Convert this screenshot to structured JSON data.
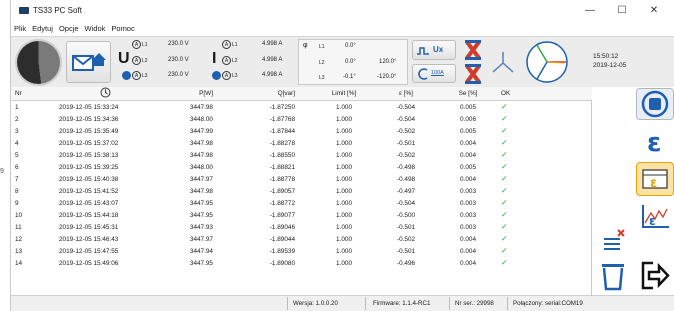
{
  "window": {
    "title": "TS33 PC Soft"
  },
  "window_controls": {
    "minimize": "—",
    "maximize": "☐",
    "close": "✕"
  },
  "menu": [
    "Plik",
    "Edytuj",
    "Opcje",
    "Widok",
    "Pomoc"
  ],
  "meters": {
    "u_symbol": "U",
    "i_symbol": "I",
    "phi_symbol": "φ",
    "voltage": [
      {
        "label": "L1",
        "value": "230.0 V"
      },
      {
        "label": "L2",
        "value": "230.0 V"
      },
      {
        "label": "L3",
        "value": "230.0 V"
      }
    ],
    "current": [
      {
        "label": "L1",
        "value": "4.998 A"
      },
      {
        "label": "L2",
        "value": "4.998 A"
      },
      {
        "label": "L3",
        "value": "4.998 A"
      }
    ],
    "phase": [
      {
        "label": "L1",
        "angle": "0.0°",
        "extra": ""
      },
      {
        "label": "L2",
        "angle": "0.0°",
        "extra": "120.0°"
      },
      {
        "label": "L3",
        "angle": "-0.1°",
        "extra": "-120.0°"
      }
    ],
    "ux_label": "Ux",
    "ct_label": "100A"
  },
  "clock": {
    "time": "15:50:12",
    "date": "2019-12-05"
  },
  "table": {
    "headers": [
      "Nr",
      "",
      "P[W]",
      "Q[var]",
      "Limit [%]",
      "ε [%]",
      "Se [%]",
      "OK"
    ],
    "rows": [
      [
        "1",
        "2019-12-05 15:33:24",
        "3447.98",
        "-1.87250",
        "1.000",
        "-0.504",
        "0.005",
        "✓"
      ],
      [
        "2",
        "2019-12-05 15:34:36",
        "3448.00",
        "-1.87768",
        "1.000",
        "-0.504",
        "0.006",
        "✓"
      ],
      [
        "3",
        "2019-12-05 15:35:49",
        "3447.99",
        "-1.87844",
        "1.000",
        "-0.502",
        "0.005",
        "✓"
      ],
      [
        "4",
        "2019-12-05 15:37:02",
        "3447.98",
        "-1.88278",
        "1.000",
        "-0.501",
        "0.004",
        "✓"
      ],
      [
        "5",
        "2019-12-05 15:38:13",
        "3447.98",
        "-1.88550",
        "1.000",
        "-0.502",
        "0.004",
        "✓"
      ],
      [
        "6",
        "2019-12-05 15:39:25",
        "3448.00",
        "-1.88821",
        "1.000",
        "-0.498",
        "0.005",
        "✓"
      ],
      [
        "7",
        "2019-12-05 15:40:38",
        "3447.97",
        "-1.88778",
        "1.000",
        "-0.498",
        "0.004",
        "✓"
      ],
      [
        "8",
        "2019-12-05 15:41:52",
        "3447.98",
        "-1.89057",
        "1.000",
        "-0.497",
        "0.003",
        "✓"
      ],
      [
        "9",
        "2019-12-05 15:43:07",
        "3447.95",
        "-1.88772",
        "1.000",
        "-0.504",
        "0.003",
        "✓"
      ],
      [
        "10",
        "2019-12-05 15:44:18",
        "3447.95",
        "-1.89077",
        "1.000",
        "-0.500",
        "0.003",
        "✓"
      ],
      [
        "11",
        "2019-12-05 15:45:31",
        "3447.93",
        "-1.89046",
        "1.000",
        "-0.501",
        "0.003",
        "✓"
      ],
      [
        "12",
        "2019-12-05 15:46:43",
        "3447.97",
        "-1.89044",
        "1.000",
        "-0.502",
        "0.004",
        "✓"
      ],
      [
        "13",
        "2019-12-05 15:47:55",
        "3447.94",
        "-1.89539",
        "1.000",
        "-0.501",
        "0.004",
        "✓"
      ],
      [
        "14",
        "2019-12-05 15:49:06",
        "3447.95",
        "-1.89080",
        "1.000",
        "-0.496",
        "0.004",
        "✓"
      ]
    ]
  },
  "side_glyph": "9",
  "status": {
    "version": "Wersja: 1.0.0.20",
    "firmware": "Firmware: 1.1.4-RC1",
    "serial_nr": "Nr ser.: 29998",
    "connection": "Połączony: serial:COM19"
  },
  "colors": {
    "accent_blue": "#1f5fb0",
    "ok_green": "#2ea94a",
    "stop_red": "#d23b2a",
    "orange": "#f2a100"
  }
}
